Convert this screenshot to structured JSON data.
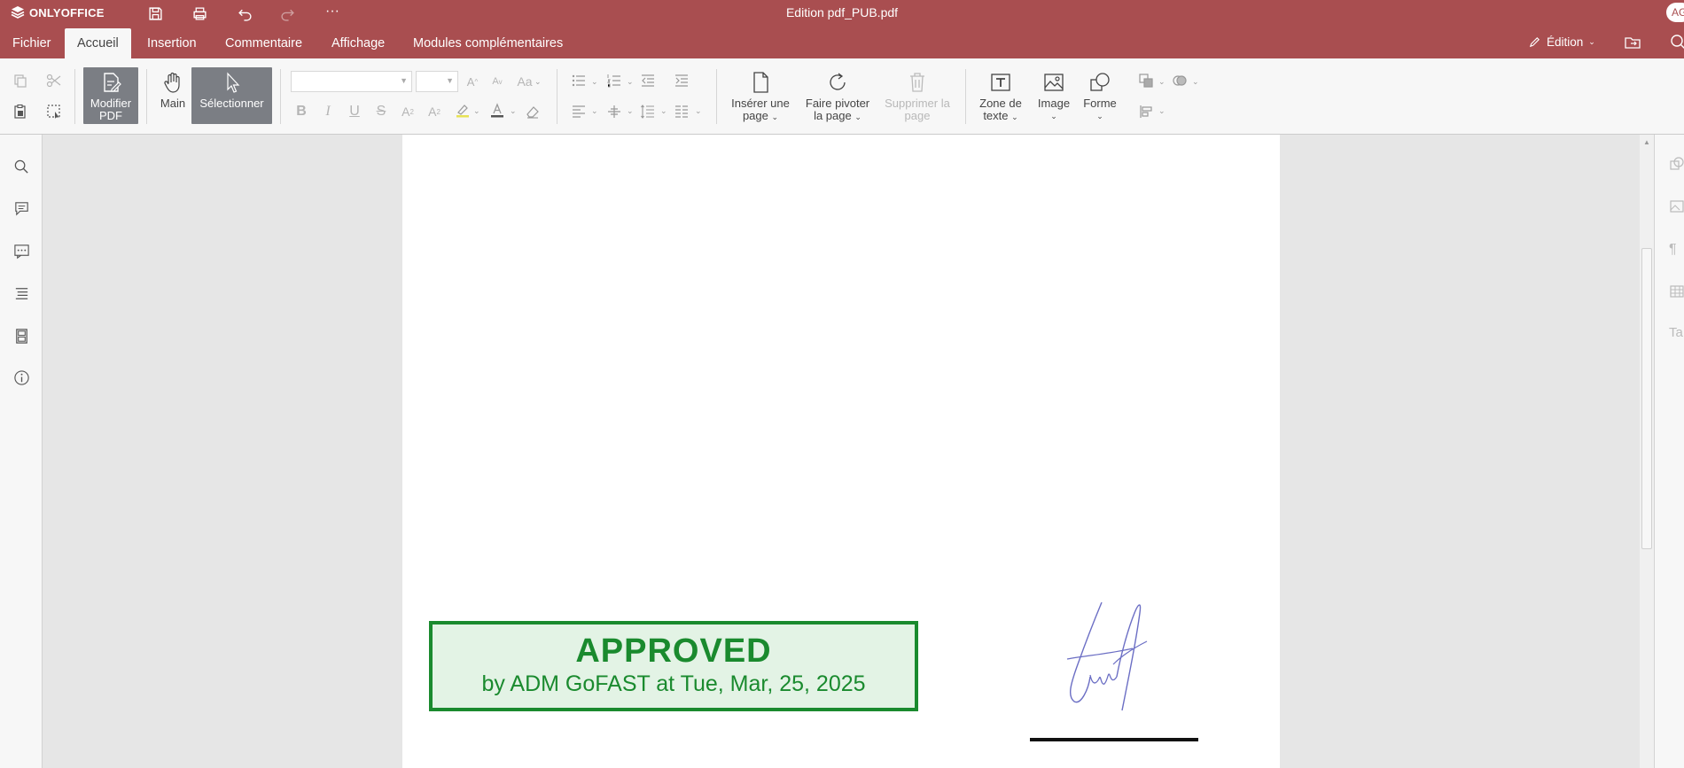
{
  "header": {
    "brand": "ONLYOFFICE",
    "title": "Edition pdf_PUB.pdf",
    "avatar": "AG",
    "accent": "#a94e50"
  },
  "tabs": [
    {
      "label": "Fichier"
    },
    {
      "label": "Accueil"
    },
    {
      "label": "Insertion"
    },
    {
      "label": "Commentaire"
    },
    {
      "label": "Affichage"
    },
    {
      "label": "Modules complémentaires"
    }
  ],
  "edition": {
    "label": "Édition"
  },
  "toolbar": {
    "modifier_pdf": "Modifier PDF",
    "main": "Main",
    "selectionner": "Sélectionner",
    "inserer_page_1": "Insérer une",
    "inserer_page_2": "page",
    "pivoter_1": "Faire pivoter",
    "pivoter_2": "la page",
    "supprimer_1": "Supprimer la",
    "supprimer_2": "page",
    "zone_texte_1": "Zone de",
    "zone_texte_2": "texte",
    "image": "Image",
    "forme": "Forme"
  },
  "document": {
    "stamp_title": "APPROVED",
    "stamp_subtitle": "by ADM GoFAST at Tue, Mar, 25, 2025",
    "stamp_color": "#1a8a2e"
  }
}
